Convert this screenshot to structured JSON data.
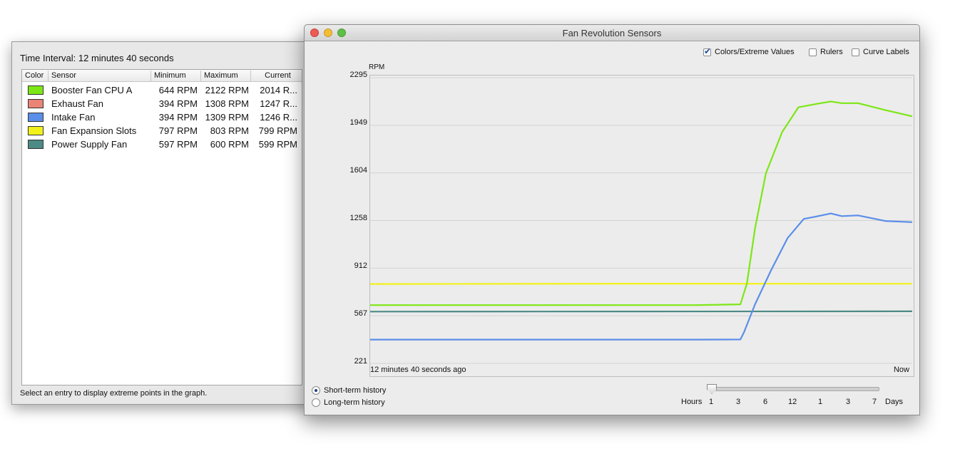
{
  "sensor_window": {
    "interval_text": "Time Interval: 12 minutes 40 seconds",
    "columns": [
      "Color",
      "Sensor",
      "Minimum",
      "Maximum",
      "Current"
    ],
    "rows": [
      {
        "color": "#7de615",
        "sensor": "Booster Fan CPU A",
        "min": "644 RPM",
        "max": "2122 RPM",
        "cur": "2014 R..."
      },
      {
        "color": "#e98476",
        "sensor": "Exhaust Fan",
        "min": "394 RPM",
        "max": "1308 RPM",
        "cur": "1247 R..."
      },
      {
        "color": "#5b8ee8",
        "sensor": "Intake Fan",
        "min": "394 RPM",
        "max": "1309 RPM",
        "cur": "1246 R..."
      },
      {
        "color": "#f2f21a",
        "sensor": "Fan Expansion Slots",
        "min": "797 RPM",
        "max": "803 RPM",
        "cur": "799 RPM"
      },
      {
        "color": "#4d8a86",
        "sensor": "Power Supply Fan",
        "min": "597 RPM",
        "max": "600 RPM",
        "cur": "599 RPM"
      }
    ],
    "status_text": "Select an entry to display extreme points in the graph."
  },
  "graph_window": {
    "title": "Fan Revolution Sensors",
    "options": {
      "colors_extreme": {
        "label": "Colors/Extreme Values",
        "checked": true
      },
      "rulers": {
        "label": "Rulers",
        "checked": false
      },
      "curve_labels": {
        "label": "Curve Labels",
        "checked": false
      }
    },
    "history": {
      "short_term": "Short-term history",
      "long_term": "Long-term history",
      "selected": "short_term"
    },
    "slider": {
      "hours_label": "Hours",
      "days_label": "Days",
      "ticks": [
        "1",
        "3",
        "6",
        "12",
        "1",
        "3",
        "7"
      ],
      "selected_tick": "1"
    }
  },
  "chart_data": {
    "type": "line",
    "ylabel": "RPM",
    "y_ticks": [
      221,
      567,
      912,
      1258,
      1604,
      1949,
      2295
    ],
    "ylim": [
      221,
      2295
    ],
    "x_start_label": "12 minutes 40 seconds ago",
    "x_end_label": "Now",
    "xlim": [
      0,
      1
    ],
    "grid": true,
    "series": [
      {
        "name": "Power Supply Fan",
        "color": "#4d8a86",
        "x": [
          0,
          0.5,
          1
        ],
        "y": [
          597,
          598,
          599
        ]
      },
      {
        "name": "Fan Expansion Slots",
        "color": "#f2f21a",
        "x": [
          0,
          0.5,
          1
        ],
        "y": [
          797,
          800,
          799
        ]
      },
      {
        "name": "Booster Fan CPU A",
        "color": "#7de615",
        "x": [
          0,
          0.3,
          0.6,
          0.683,
          0.695,
          0.71,
          0.73,
          0.76,
          0.79,
          0.82,
          0.85,
          0.87,
          0.9,
          0.95,
          1.0
        ],
        "y": [
          644,
          644,
          644,
          650,
          800,
          1200,
          1600,
          1900,
          2080,
          2102,
          2122,
          2110,
          2110,
          2060,
          2014
        ]
      },
      {
        "name": "Intake Fan",
        "color": "#5b8ee8",
        "x": [
          0,
          0.3,
          0.6,
          0.683,
          0.69,
          0.71,
          0.74,
          0.77,
          0.8,
          0.82,
          0.85,
          0.87,
          0.9,
          0.95,
          1.0
        ],
        "y": [
          394,
          394,
          394,
          395,
          450,
          650,
          900,
          1130,
          1270,
          1285,
          1309,
          1290,
          1295,
          1255,
          1246
        ]
      }
    ]
  }
}
